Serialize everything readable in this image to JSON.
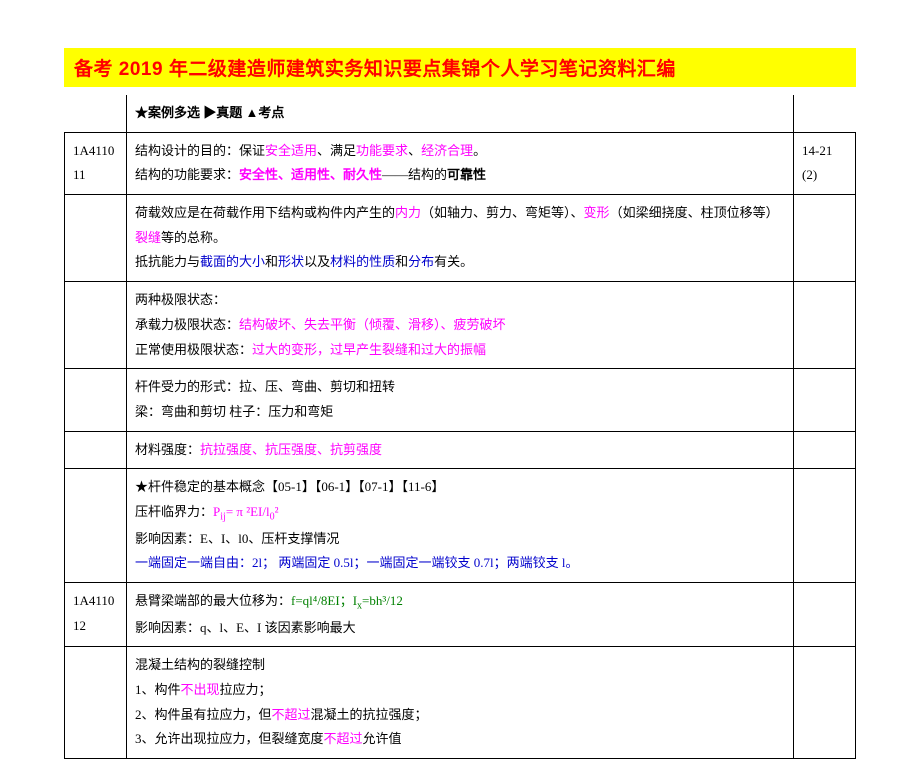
{
  "title": "备考 2019 年二级建造师建筑实务知识要点集锦个人学习笔记资料汇编",
  "legend": "★案例多选 ▶真题 ▲考点",
  "codes": {
    "c1": "1A411011",
    "c2": "1A411012"
  },
  "r1": {
    "a": "结构设计的目的：保证",
    "b": "安全适用",
    "c": "、满足",
    "d": "功能要求",
    "e": "、",
    "f": "经济合理",
    "g": "。",
    "h": "结构的功能要求：",
    "i": "安全性、适用性、耐久性",
    "j": "——结构的",
    "k": "可靠性",
    "right": "14-21(2)"
  },
  "r2": {
    "a": "荷载效应是在荷载作用下结构或构件内产生的",
    "b": "内力",
    "c": "（如轴力、剪力、弯矩等）、",
    "d": "变形",
    "e": "（如梁细挠度、柱顶位移等）",
    "f": "裂缝",
    "g": "等的总称。",
    "h": "抵抗能力与",
    "i": "截面的大小",
    "j": "和",
    "k": "形状",
    "l": "以及",
    "m": "材料的性质",
    "n": "和",
    "o": "分布",
    "p": "有关。"
  },
  "r3": {
    "a": "两种极限状态：",
    "b": "承载力极限状态：",
    "c": "结构破坏、失去平衡（倾覆、滑移）、疲劳破坏",
    "d": "正常使用极限状态：",
    "e": "过大的变形，过早产生裂缝和过大的振幅"
  },
  "r4": {
    "a": "杆件受力的形式：拉、压、弯曲、剪切和扭转",
    "b": "梁：弯曲和剪切    柱子：压力和弯矩"
  },
  "r5": {
    "a": "材料强度：",
    "b": "抗拉强度、抗压强度、抗剪强度"
  },
  "r6": {
    "a": "★杆件稳定的基本概念【05-1】【06-1】【07-1】【11-6】",
    "b": "压杆临界力：",
    "c": "P",
    "c_sub": "ij",
    "c2": "= π ²EI/l",
    "c3": "0",
    "c4": "²",
    "d": "影响因素：E、I、l0、压杆支撑情况",
    "e": "一端固定一端自由：2l； 两端固定 0.5l；一端固定一端铰支 0.7l；两端铰支 l。"
  },
  "r7": {
    "a": "悬臂梁端部的最大位移为：",
    "b": "f=ql⁴/8EI；I",
    "b_sub": "x",
    "b2": "=bh³/12",
    "c": "影响因素：q、l、E、I 该因素影响最大"
  },
  "r8": {
    "a": "混凝土结构的裂缝控制",
    "b": "1、构件",
    "c": "不出现",
    "d": "拉应力；",
    "e": "2、构件虽有拉应力，但",
    "f": "不超过",
    "g": "混凝土的抗拉强度；",
    "h": "3、允许出现拉应力，但裂缝宽度",
    "i": "不超过",
    "j": "允许值"
  }
}
